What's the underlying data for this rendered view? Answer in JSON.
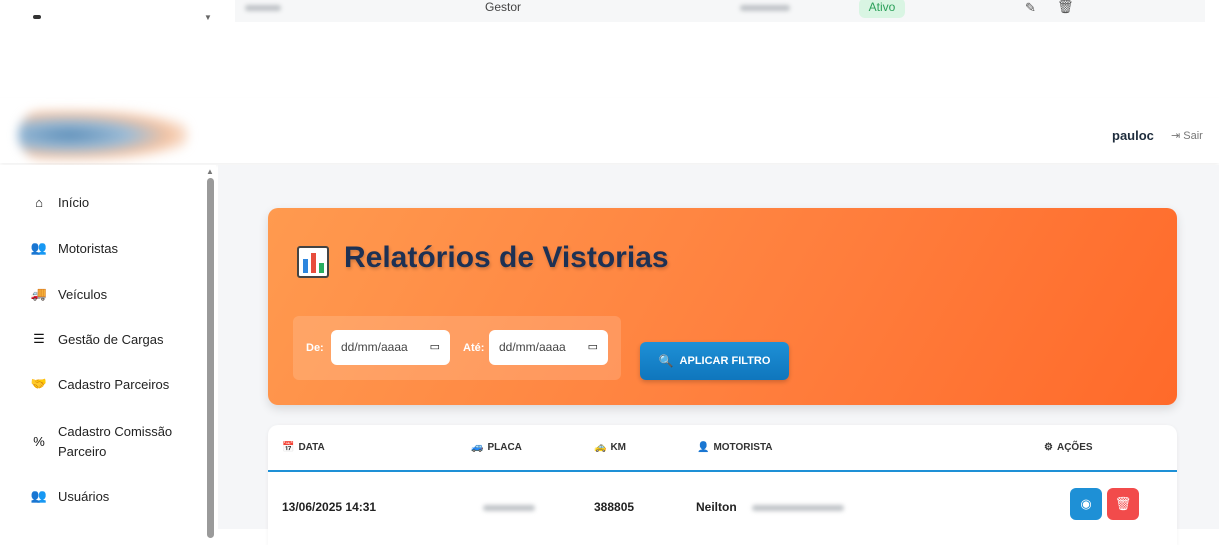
{
  "top_row": {
    "role": "Gestor",
    "status": "Ativo"
  },
  "header": {
    "username": "pauloc",
    "logout_label": "Sair"
  },
  "sidebar": {
    "items": [
      {
        "label": "Início",
        "icon": "home-icon"
      },
      {
        "label": "Motoristas",
        "icon": "users-icon"
      },
      {
        "label": "Veículos",
        "icon": "truck-icon"
      },
      {
        "label": "Gestão de Cargas",
        "icon": "list-check-icon"
      },
      {
        "label": "Cadastro Parceiros",
        "icon": "handshake-icon"
      },
      {
        "label": "Cadastro Comissão Parceiro",
        "icon": "percent-icon"
      },
      {
        "label": "Usuários",
        "icon": "users-icon"
      }
    ]
  },
  "page": {
    "title": "Relatórios de Vistorias",
    "filter": {
      "from_label": "De:",
      "to_label": "Até:",
      "from_placeholder": "dd/mm/aaaa",
      "to_placeholder": "dd/mm/aaaa",
      "apply_label": "APLICAR FILTRO"
    }
  },
  "table": {
    "columns": [
      "DATA",
      "PLACA",
      "KM",
      "MOTORISTA",
      "AÇÕES"
    ],
    "rows": [
      {
        "data": "13/06/2025 14:31",
        "km": "388805",
        "motorista": "Neilton"
      }
    ]
  },
  "colors": {
    "accent_orange": "#ff7d3c",
    "primary_blue": "#1e90d6",
    "danger_red": "#f24b4b",
    "title_navy": "#1d3154"
  }
}
